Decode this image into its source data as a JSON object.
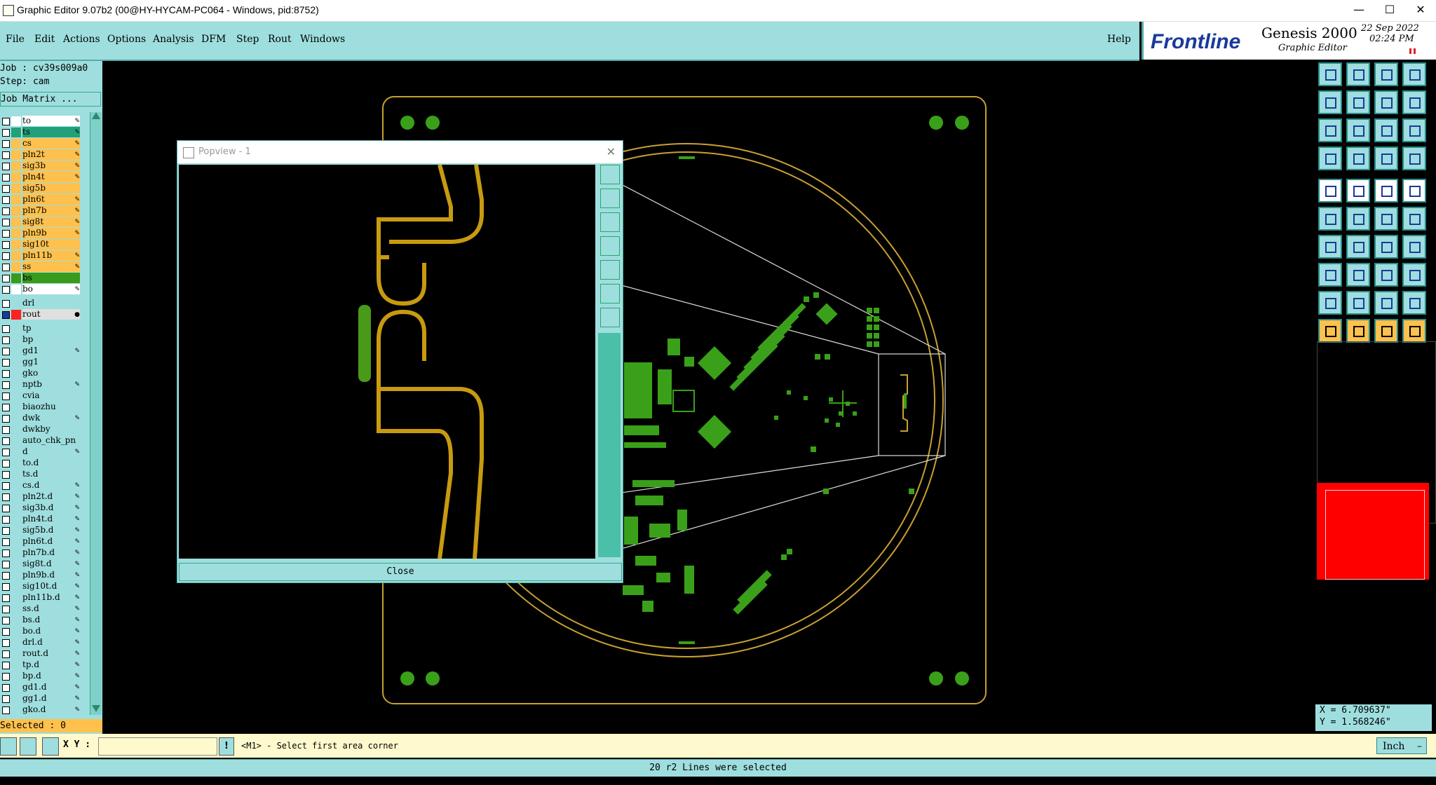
{
  "window": {
    "title": "Graphic Editor 9.07b2 (00@HY-HYCAM-PC064 - Windows, pid:8752)"
  },
  "menu": [
    "File",
    "Edit",
    "Actions",
    "Options",
    "Analysis",
    "DFM",
    "Step",
    "Rout",
    "Windows"
  ],
  "help_label": "Help",
  "logo": {
    "brand": "Frontline",
    "product": "Genesis 2000",
    "subtitle": "Graphic Editor",
    "date": "22 Sep 2022",
    "time": "02:24 PM"
  },
  "job": {
    "job_line": "Job : cv39s009a0",
    "step_line": "Step: cam",
    "matrix_button": "Job Matrix ..."
  },
  "layers": {
    "board": [
      {
        "name": "to",
        "color": "#ffffff",
        "mark": "edit"
      },
      {
        "name": "ts",
        "color": "#22a07a",
        "mark": "edit"
      },
      {
        "name": "cs",
        "color": "#ffc14d",
        "mark": "edit"
      },
      {
        "name": "pln2t",
        "color": "#ffc14d",
        "mark": "edit"
      },
      {
        "name": "sig3b",
        "color": "#ffc14d",
        "mark": "edit"
      },
      {
        "name": "pln4t",
        "color": "#ffc14d",
        "mark": "edit"
      },
      {
        "name": "sig5b",
        "color": "#ffc14d",
        "mark": ""
      },
      {
        "name": "pln6t",
        "color": "#ffc14d",
        "mark": "edit"
      },
      {
        "name": "pln7b",
        "color": "#ffc14d",
        "mark": "edit"
      },
      {
        "name": "sig8t",
        "color": "#ffc14d",
        "mark": "edit"
      },
      {
        "name": "pln9b",
        "color": "#ffc14d",
        "mark": "edit"
      },
      {
        "name": "sig10t",
        "color": "#ffc14d",
        "mark": ""
      },
      {
        "name": "pln11b",
        "color": "#ffc14d",
        "mark": "edit"
      },
      {
        "name": "ss",
        "color": "#ffc14d",
        "mark": "edit"
      },
      {
        "name": "bs",
        "color": "#3a9a1a",
        "mark": ""
      },
      {
        "name": "bo",
        "color": "#ffffff",
        "mark": "edit"
      }
    ],
    "drill": [
      {
        "name": "drl",
        "color": "#9fdede",
        "mark": ""
      },
      {
        "name": "rout",
        "color": "#e0e0e0",
        "mark": "dot"
      }
    ],
    "misc": [
      "tp",
      "bp",
      "gd1",
      "gg1",
      "gko",
      "nptb",
      "cvia",
      "biaozhu",
      "dwk",
      "dwkby",
      "auto_chk_pn",
      "d",
      "to.d",
      "ts.d",
      "cs.d",
      "pln2t.d",
      "sig3b.d",
      "pln4t.d",
      "sig5b.d",
      "pln6t.d",
      "pln7b.d",
      "sig8t.d",
      "pln9b.d",
      "sig10t.d",
      "pln11b.d",
      "ss.d",
      "bs.d",
      "bo.d",
      "drl.d",
      "rout.d",
      "tp.d",
      "bp.d",
      "gd1.d",
      "gg1.d",
      "gko.d"
    ]
  },
  "selected": "Selected : 0",
  "popview": {
    "title": "Popview - 1",
    "close_label": "Close"
  },
  "coords": {
    "x": "X = 6.709637\"",
    "y": "Y = 1.568246\""
  },
  "command": {
    "xy_label": "X Y :",
    "input_value": "",
    "prompt": "<M1> - Select first area corner",
    "units": "Inch"
  },
  "status": "20 r2 Lines were selected"
}
